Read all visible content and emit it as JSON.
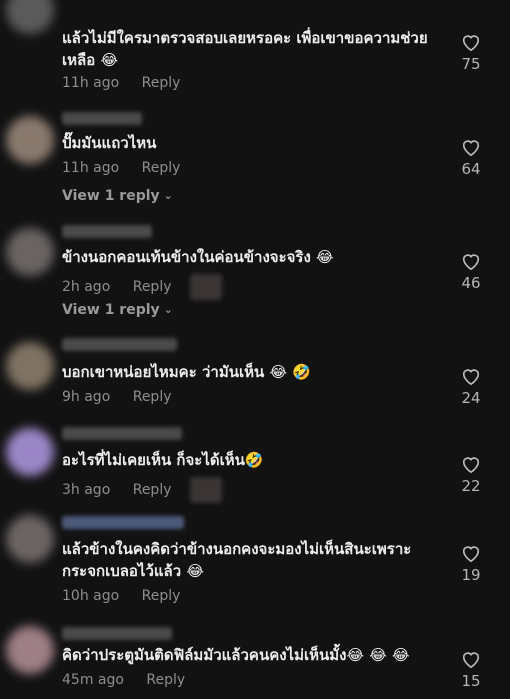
{
  "comments": [
    {
      "text": "แล้วไม่มีใครมาตรวจสอบเลยหรอคะ เพื่อเขาขอความช่วยเหลือ 😂",
      "time": "11h ago",
      "reply": "Reply",
      "likes": "75"
    },
    {
      "text": "ปั๊มมันแถวไหน",
      "time": "11h ago",
      "reply": "Reply",
      "likes": "64",
      "view_replies": "View 1 reply"
    },
    {
      "text": "ข้างนอกคอนเท้นข้างในค่อนข้างจะจริง 😂",
      "time": "2h ago",
      "reply": "Reply",
      "likes": "46",
      "view_replies": "View 1 reply"
    },
    {
      "text": "บอกเขาหน่อยไหมคะ ว่ามันเห็น 😂 🤣",
      "time": "9h ago",
      "reply": "Reply",
      "likes": "24"
    },
    {
      "text": "อะไรที่ไม่เคยเห็น ก็จะได้เห็น🤣",
      "time": "3h ago",
      "reply": "Reply",
      "likes": "22"
    },
    {
      "text": "แล้วข้างในคงคิดว่าข้างนอกคงจะมองไม่เห็นสินะเพราะกระจกเบลอไว้แล้ว 😂",
      "time": "10h ago",
      "reply": "Reply",
      "likes": "19"
    },
    {
      "text": "คิดว่าประตูมันติดฟิล์มมัวแล้วคนคงไม่เห็นมั้ง😂 😂 😂",
      "time": "45m ago",
      "reply": "Reply",
      "likes": "15"
    }
  ],
  "colors": {
    "background": "#121212",
    "text": "#ededed",
    "muted": "#8e8e8e"
  },
  "icons": {
    "like": "heart-outline-icon",
    "expand": "chevron-down-icon"
  }
}
